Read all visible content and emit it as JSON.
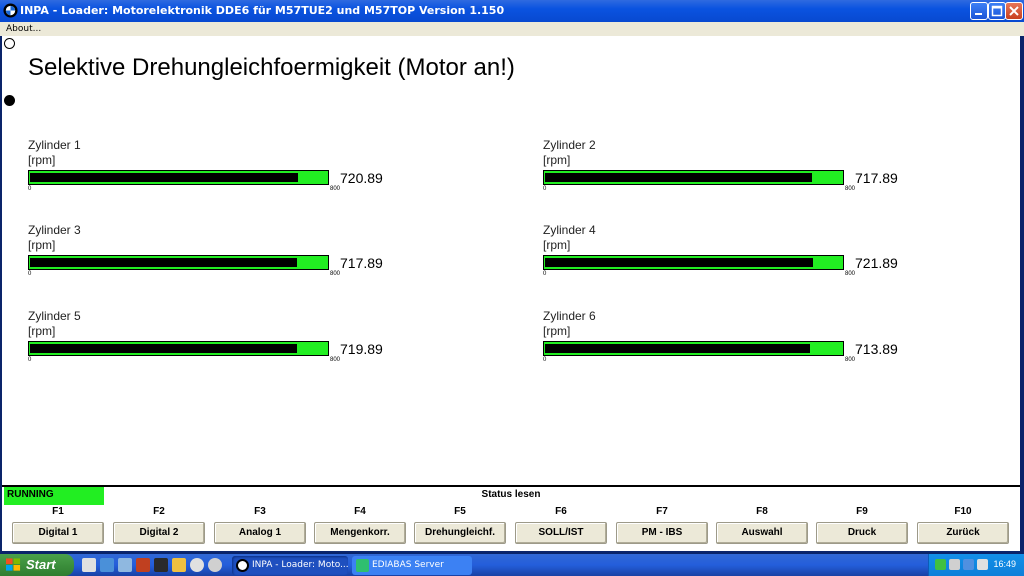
{
  "window": {
    "title": "INPA - Loader:  Motorelektronik DDE6 für M57TUE2 und M57TOP Version 1.150",
    "menu": [
      "About..."
    ]
  },
  "page": {
    "title": "Selektive Drehungleichfoermigkeit (Motor an!)"
  },
  "gauge_scale": {
    "min": "0",
    "max": "800",
    "min_value": 0,
    "max_value": 800
  },
  "cylinders": [
    {
      "label": "Zylinder 1",
      "unit": "[rpm]",
      "value": "720.89",
      "numeric": 720.89
    },
    {
      "label": "Zylinder 2",
      "unit": "[rpm]",
      "value": "717.89",
      "numeric": 717.89
    },
    {
      "label": "Zylinder 3",
      "unit": "[rpm]",
      "value": "717.89",
      "numeric": 717.89
    },
    {
      "label": "Zylinder 4",
      "unit": "[rpm]",
      "value": "721.89",
      "numeric": 721.89
    },
    {
      "label": "Zylinder 5",
      "unit": "[rpm]",
      "value": "719.89",
      "numeric": 719.89
    },
    {
      "label": "Zylinder 6",
      "unit": "[rpm]",
      "value": "713.89",
      "numeric": 713.89
    }
  ],
  "status": {
    "running": "RUNNING",
    "mode": "Status lesen",
    "running_color": "#22ee22"
  },
  "fkeys": [
    {
      "key": "F1",
      "label": "Digital 1"
    },
    {
      "key": "F2",
      "label": "Digital 2"
    },
    {
      "key": "F3",
      "label": "Analog 1"
    },
    {
      "key": "F4",
      "label": "Mengenkorr."
    },
    {
      "key": "F5",
      "label": "Drehungleichf."
    },
    {
      "key": "F6",
      "label": "SOLL/IST"
    },
    {
      "key": "F7",
      "label": "PM - IBS"
    },
    {
      "key": "F8",
      "label": "Auswahl"
    },
    {
      "key": "F9",
      "label": "Druck"
    },
    {
      "key": "F10",
      "label": "Zurück"
    }
  ],
  "taskbar": {
    "start": "Start",
    "tasks": [
      "INPA - Loader:  Moto...",
      "EDIABAS Server"
    ],
    "clock": "16:49"
  }
}
